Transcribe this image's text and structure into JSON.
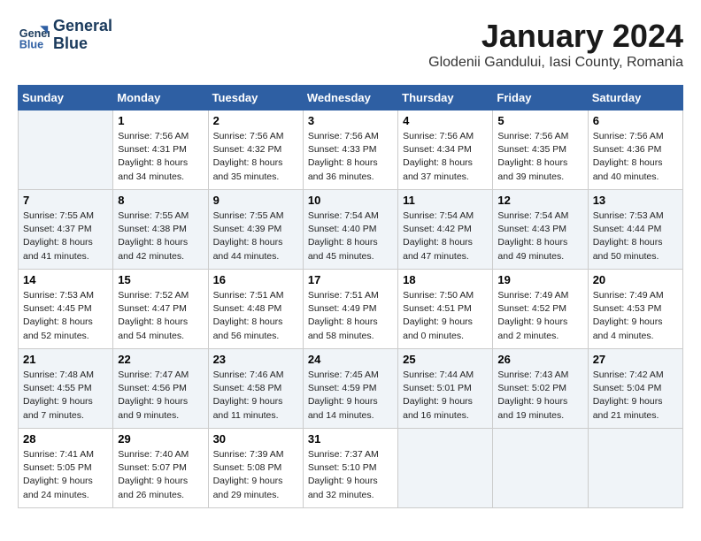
{
  "header": {
    "logo_line1": "General",
    "logo_line2": "Blue",
    "month": "January 2024",
    "location": "Glodenii Gandului, Iasi County, Romania"
  },
  "weekdays": [
    "Sunday",
    "Monday",
    "Tuesday",
    "Wednesday",
    "Thursday",
    "Friday",
    "Saturday"
  ],
  "weeks": [
    [
      {
        "day": "",
        "info": ""
      },
      {
        "day": "1",
        "info": "Sunrise: 7:56 AM\nSunset: 4:31 PM\nDaylight: 8 hours\nand 34 minutes."
      },
      {
        "day": "2",
        "info": "Sunrise: 7:56 AM\nSunset: 4:32 PM\nDaylight: 8 hours\nand 35 minutes."
      },
      {
        "day": "3",
        "info": "Sunrise: 7:56 AM\nSunset: 4:33 PM\nDaylight: 8 hours\nand 36 minutes."
      },
      {
        "day": "4",
        "info": "Sunrise: 7:56 AM\nSunset: 4:34 PM\nDaylight: 8 hours\nand 37 minutes."
      },
      {
        "day": "5",
        "info": "Sunrise: 7:56 AM\nSunset: 4:35 PM\nDaylight: 8 hours\nand 39 minutes."
      },
      {
        "day": "6",
        "info": "Sunrise: 7:56 AM\nSunset: 4:36 PM\nDaylight: 8 hours\nand 40 minutes."
      }
    ],
    [
      {
        "day": "7",
        "info": "Sunrise: 7:55 AM\nSunset: 4:37 PM\nDaylight: 8 hours\nand 41 minutes."
      },
      {
        "day": "8",
        "info": "Sunrise: 7:55 AM\nSunset: 4:38 PM\nDaylight: 8 hours\nand 42 minutes."
      },
      {
        "day": "9",
        "info": "Sunrise: 7:55 AM\nSunset: 4:39 PM\nDaylight: 8 hours\nand 44 minutes."
      },
      {
        "day": "10",
        "info": "Sunrise: 7:54 AM\nSunset: 4:40 PM\nDaylight: 8 hours\nand 45 minutes."
      },
      {
        "day": "11",
        "info": "Sunrise: 7:54 AM\nSunset: 4:42 PM\nDaylight: 8 hours\nand 47 minutes."
      },
      {
        "day": "12",
        "info": "Sunrise: 7:54 AM\nSunset: 4:43 PM\nDaylight: 8 hours\nand 49 minutes."
      },
      {
        "day": "13",
        "info": "Sunrise: 7:53 AM\nSunset: 4:44 PM\nDaylight: 8 hours\nand 50 minutes."
      }
    ],
    [
      {
        "day": "14",
        "info": "Sunrise: 7:53 AM\nSunset: 4:45 PM\nDaylight: 8 hours\nand 52 minutes."
      },
      {
        "day": "15",
        "info": "Sunrise: 7:52 AM\nSunset: 4:47 PM\nDaylight: 8 hours\nand 54 minutes."
      },
      {
        "day": "16",
        "info": "Sunrise: 7:51 AM\nSunset: 4:48 PM\nDaylight: 8 hours\nand 56 minutes."
      },
      {
        "day": "17",
        "info": "Sunrise: 7:51 AM\nSunset: 4:49 PM\nDaylight: 8 hours\nand 58 minutes."
      },
      {
        "day": "18",
        "info": "Sunrise: 7:50 AM\nSunset: 4:51 PM\nDaylight: 9 hours\nand 0 minutes."
      },
      {
        "day": "19",
        "info": "Sunrise: 7:49 AM\nSunset: 4:52 PM\nDaylight: 9 hours\nand 2 minutes."
      },
      {
        "day": "20",
        "info": "Sunrise: 7:49 AM\nSunset: 4:53 PM\nDaylight: 9 hours\nand 4 minutes."
      }
    ],
    [
      {
        "day": "21",
        "info": "Sunrise: 7:48 AM\nSunset: 4:55 PM\nDaylight: 9 hours\nand 7 minutes."
      },
      {
        "day": "22",
        "info": "Sunrise: 7:47 AM\nSunset: 4:56 PM\nDaylight: 9 hours\nand 9 minutes."
      },
      {
        "day": "23",
        "info": "Sunrise: 7:46 AM\nSunset: 4:58 PM\nDaylight: 9 hours\nand 11 minutes."
      },
      {
        "day": "24",
        "info": "Sunrise: 7:45 AM\nSunset: 4:59 PM\nDaylight: 9 hours\nand 14 minutes."
      },
      {
        "day": "25",
        "info": "Sunrise: 7:44 AM\nSunset: 5:01 PM\nDaylight: 9 hours\nand 16 minutes."
      },
      {
        "day": "26",
        "info": "Sunrise: 7:43 AM\nSunset: 5:02 PM\nDaylight: 9 hours\nand 19 minutes."
      },
      {
        "day": "27",
        "info": "Sunrise: 7:42 AM\nSunset: 5:04 PM\nDaylight: 9 hours\nand 21 minutes."
      }
    ],
    [
      {
        "day": "28",
        "info": "Sunrise: 7:41 AM\nSunset: 5:05 PM\nDaylight: 9 hours\nand 24 minutes."
      },
      {
        "day": "29",
        "info": "Sunrise: 7:40 AM\nSunset: 5:07 PM\nDaylight: 9 hours\nand 26 minutes."
      },
      {
        "day": "30",
        "info": "Sunrise: 7:39 AM\nSunset: 5:08 PM\nDaylight: 9 hours\nand 29 minutes."
      },
      {
        "day": "31",
        "info": "Sunrise: 7:37 AM\nSunset: 5:10 PM\nDaylight: 9 hours\nand 32 minutes."
      },
      {
        "day": "",
        "info": ""
      },
      {
        "day": "",
        "info": ""
      },
      {
        "day": "",
        "info": ""
      }
    ]
  ]
}
